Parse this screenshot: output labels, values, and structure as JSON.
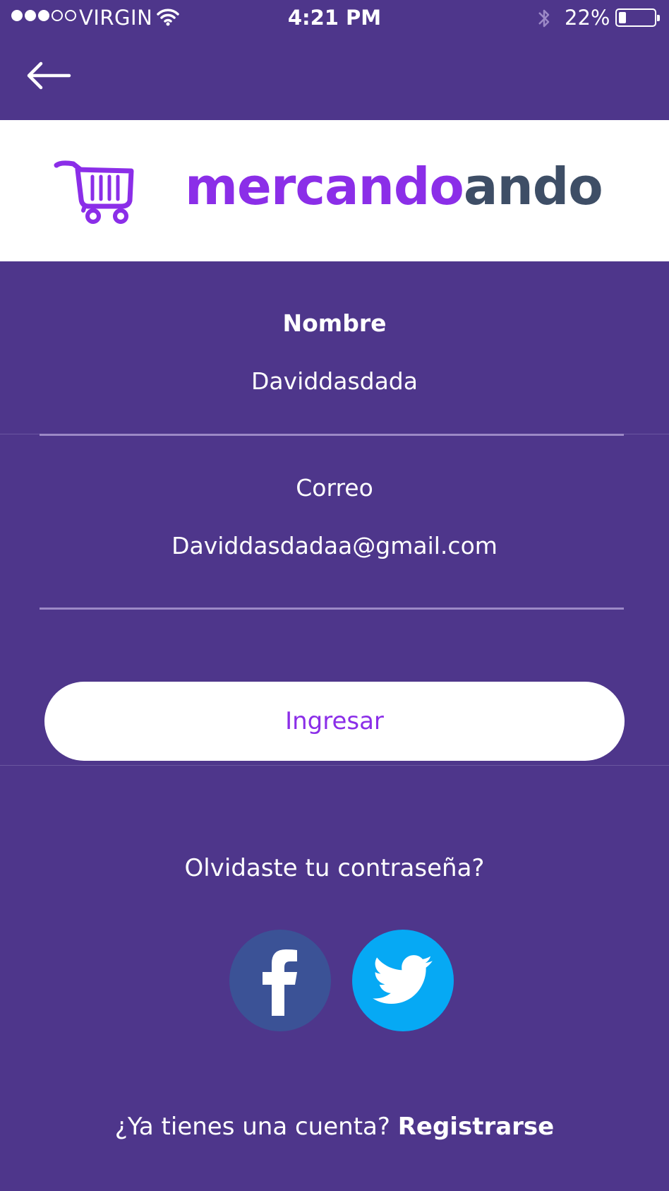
{
  "status_bar": {
    "carrier": "VIRGIN",
    "time": "4:21 PM",
    "battery": "22%",
    "battery_level": 0.22,
    "signal_bars": 3,
    "signal_total": 5
  },
  "header": {
    "back_icon": "arrow-left-icon"
  },
  "logo": {
    "icon": "shopping-cart-icon",
    "text_part1": "mercando",
    "text_part2": "ando",
    "color_part1": "#8b2ee8",
    "color_part2": "#3e4e66"
  },
  "form": {
    "name_label": "Nombre",
    "name_value": "Daviddasdada",
    "email_label": "Correo",
    "email_value": "Daviddasdadaa@gmail.com",
    "submit_label": "Ingresar"
  },
  "footer": {
    "forgot_password": "Olvidaste tu contraseña?",
    "register_prompt": "¿Ya tienes una cuenta?",
    "register_link": "Registrarse"
  },
  "social": {
    "facebook_icon": "facebook-icon",
    "twitter_icon": "twitter-icon",
    "facebook_color": "#3b5296",
    "twitter_color": "#06a9f4"
  },
  "colors": {
    "background": "#4e368b",
    "accent": "#8b2ee8"
  }
}
